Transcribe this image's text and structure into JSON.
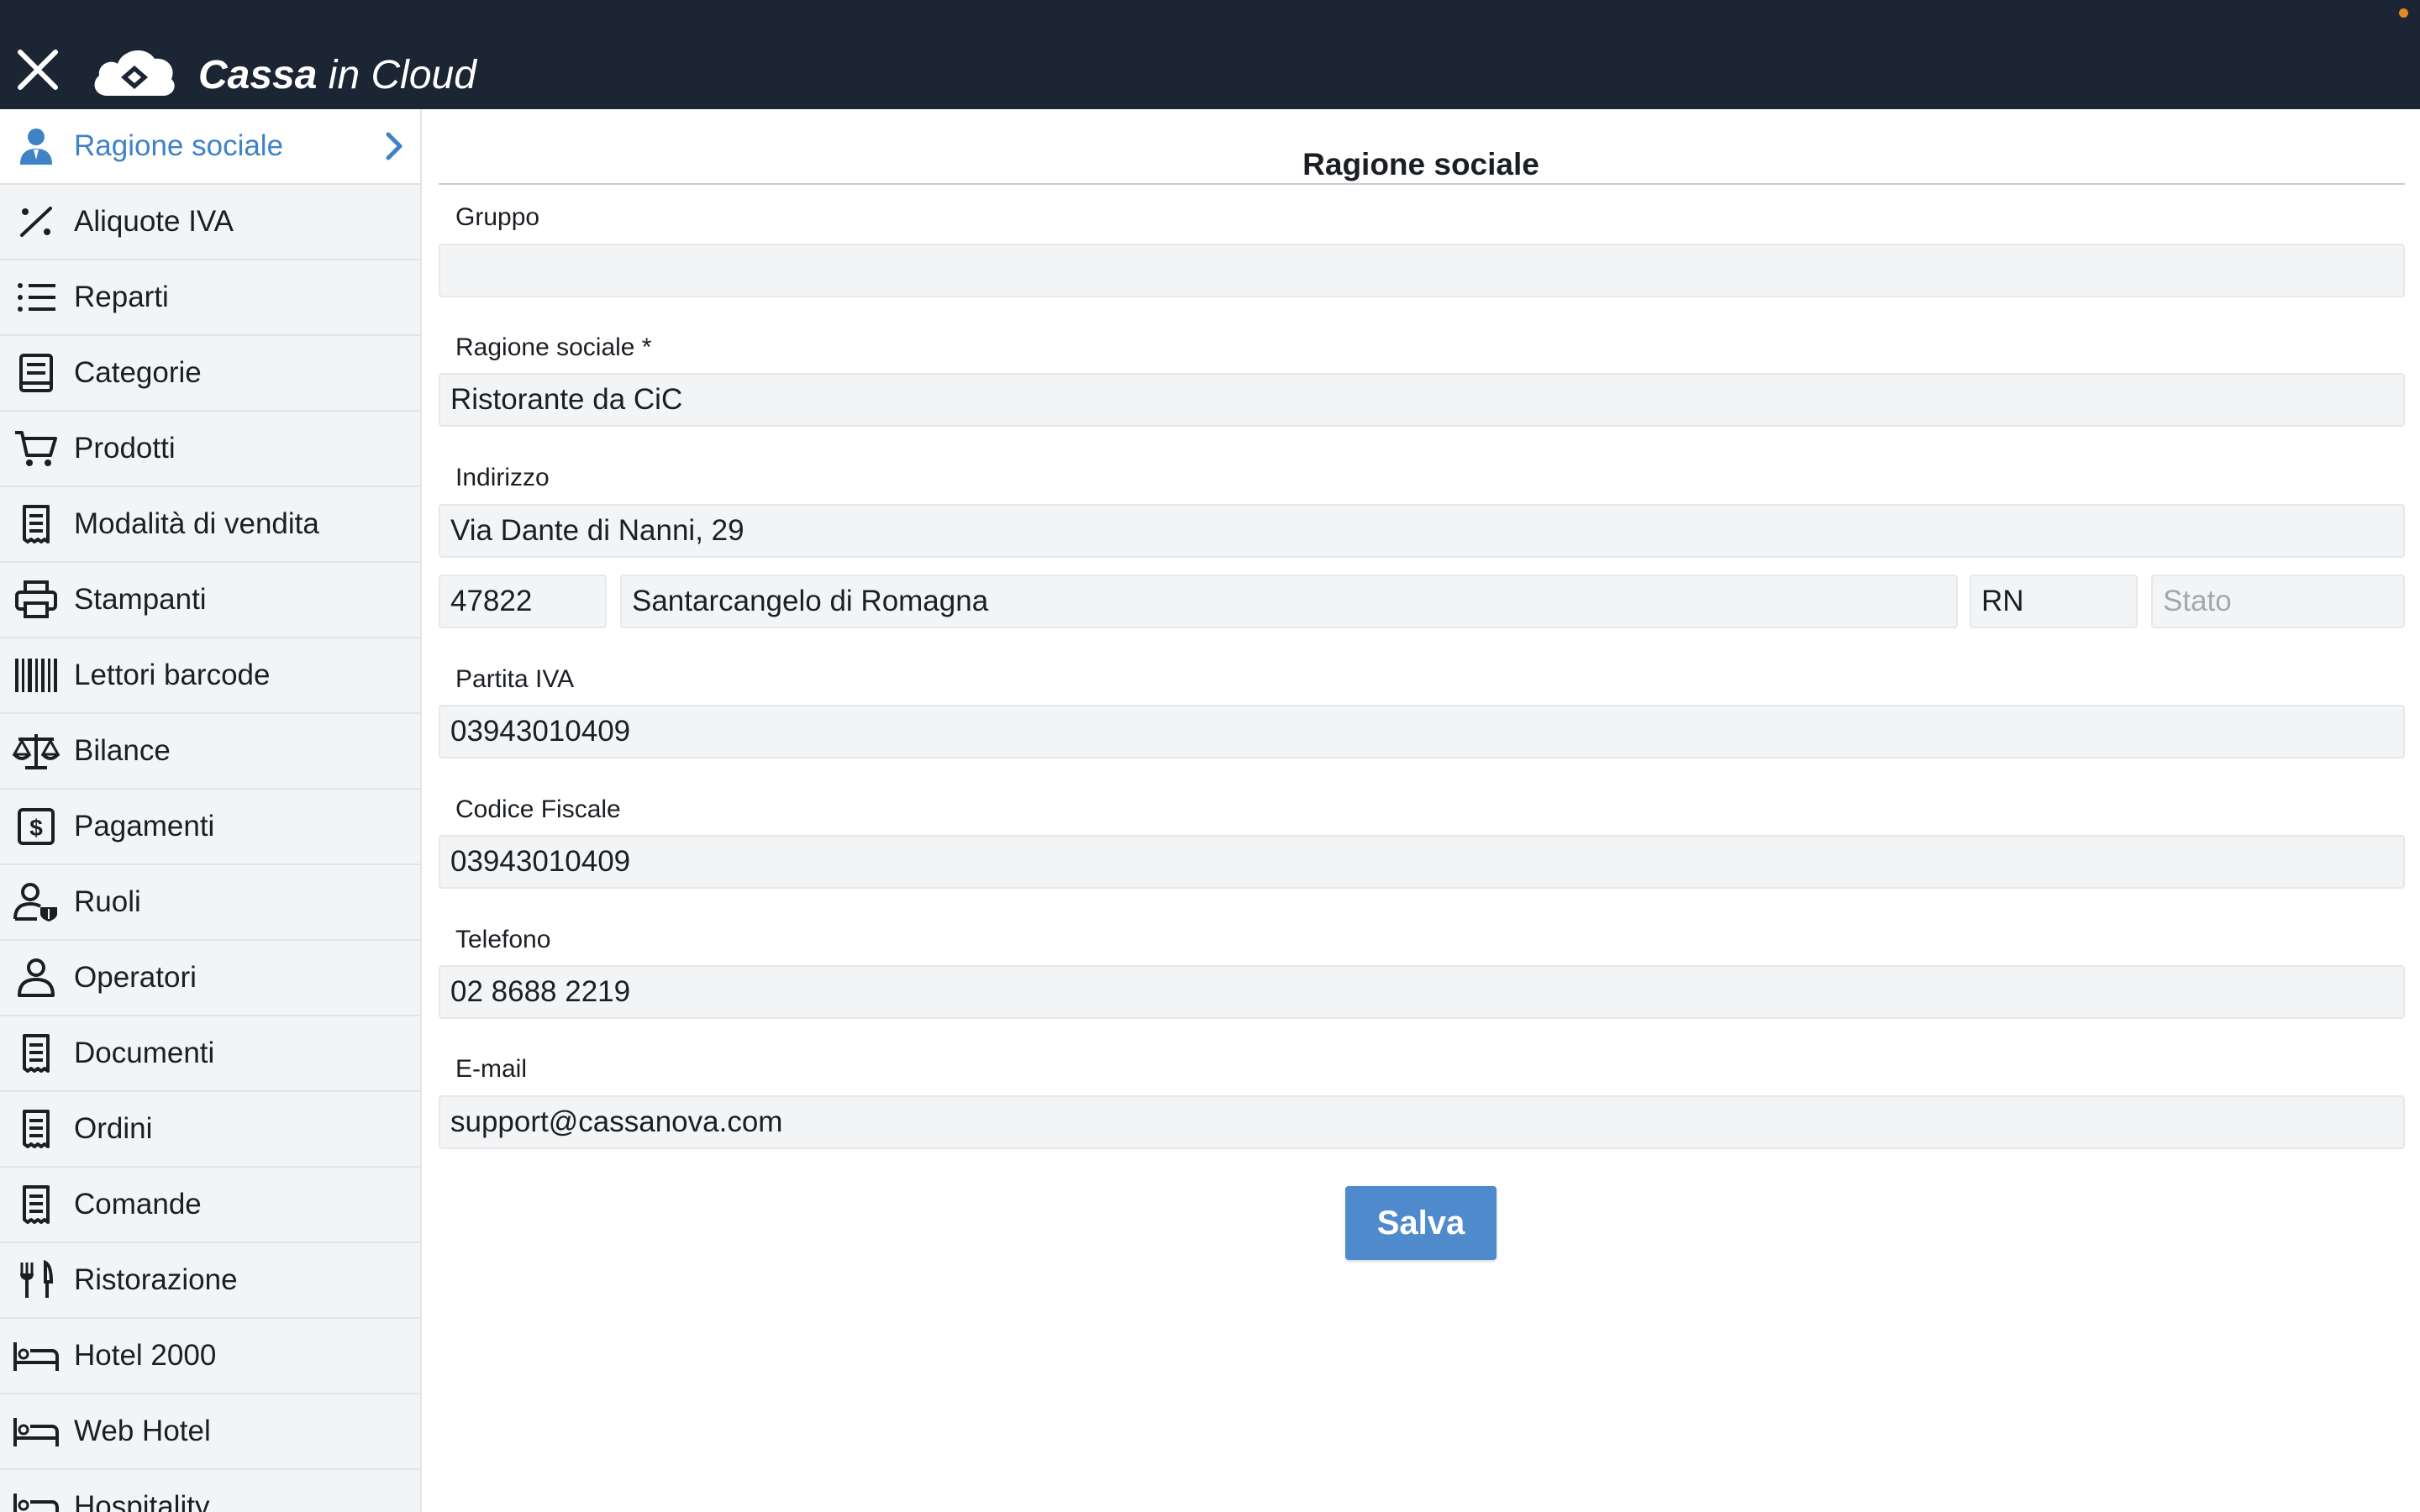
{
  "app": {
    "logo_bold": "Cassa",
    "logo_light": " in Cloud",
    "close_icon": "close-icon",
    "accent_color": "#3f82c6"
  },
  "sidebar": {
    "items": [
      {
        "label": "Ragione sociale",
        "icon": "user-icon",
        "active": true
      },
      {
        "label": "Aliquote IVA",
        "icon": "percent-icon"
      },
      {
        "label": "Reparti",
        "icon": "list-icon"
      },
      {
        "label": "Categorie",
        "icon": "book-icon"
      },
      {
        "label": "Prodotti",
        "icon": "cart-icon"
      },
      {
        "label": "Modalità di vendita",
        "icon": "receipt-icon"
      },
      {
        "label": "Stampanti",
        "icon": "printer-icon"
      },
      {
        "label": "Lettori barcode",
        "icon": "barcode-icon"
      },
      {
        "label": "Bilance",
        "icon": "scale-icon"
      },
      {
        "label": "Pagamenti",
        "icon": "dollar-icon"
      },
      {
        "label": "Ruoli",
        "icon": "user-shield-icon"
      },
      {
        "label": "Operatori",
        "icon": "user-outline-icon"
      },
      {
        "label": "Documenti",
        "icon": "receipt-icon"
      },
      {
        "label": "Ordini",
        "icon": "receipt-icon"
      },
      {
        "label": "Comande",
        "icon": "receipt-icon"
      },
      {
        "label": "Ristorazione",
        "icon": "fork-knife-icon"
      },
      {
        "label": "Hotel 2000",
        "icon": "bed-icon"
      },
      {
        "label": "Web Hotel",
        "icon": "bed-icon"
      },
      {
        "label": "Hospitality",
        "icon": "bed-icon"
      }
    ]
  },
  "form": {
    "title": "Ragione sociale",
    "gruppo_label": "Gruppo",
    "gruppo_value": "",
    "ragione_label": "Ragione sociale *",
    "ragione_value": "Ristorante da CiC",
    "indirizzo_label": "Indirizzo",
    "indirizzo_value": "Via Dante di Nanni, 29",
    "cap_value": "47822",
    "citta_value": "Santarcangelo di Romagna",
    "provincia_value": "RN",
    "stato_placeholder": "Stato",
    "piva_label": "Partita IVA",
    "piva_value": "03943010409",
    "cf_label": "Codice Fiscale",
    "cf_value": "03943010409",
    "telefono_label": "Telefono",
    "telefono_value": "02 8688 2219",
    "email_label": "E-mail",
    "email_value": "support@cassanova.com",
    "save_label": "Salva"
  }
}
